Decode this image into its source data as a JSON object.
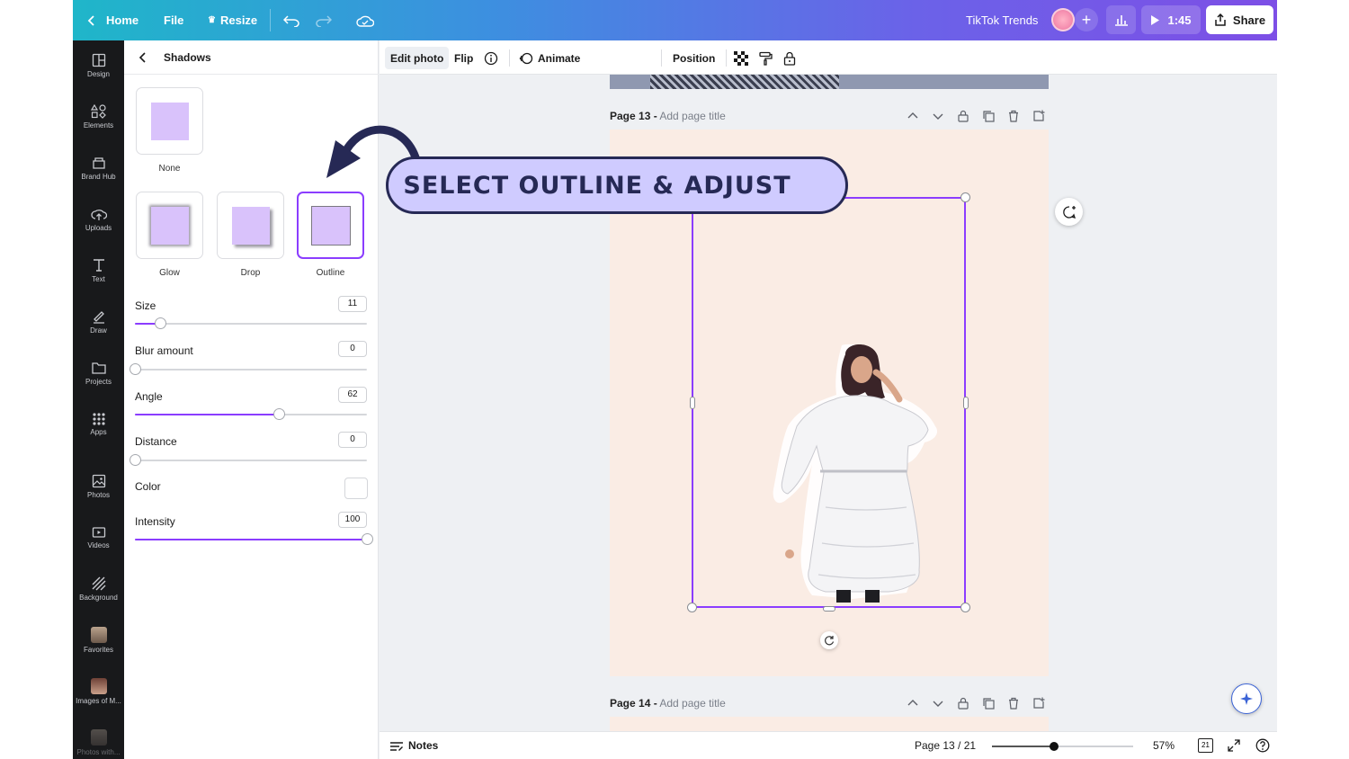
{
  "topbar": {
    "home_label": "Home",
    "file_label": "File",
    "resize_label": "Resize",
    "project_title": "TikTok Trends",
    "present_time": "1:45",
    "share_label": "Share"
  },
  "rail": {
    "items": [
      {
        "label": "Design",
        "icon": "design-icon"
      },
      {
        "label": "Elements",
        "icon": "elements-icon"
      },
      {
        "label": "Brand Hub",
        "icon": "brand-hub-icon"
      },
      {
        "label": "Uploads",
        "icon": "cloud-upload-icon"
      },
      {
        "label": "Text",
        "icon": "text-icon"
      },
      {
        "label": "Draw",
        "icon": "draw-icon"
      },
      {
        "label": "Projects",
        "icon": "folder-icon"
      },
      {
        "label": "Apps",
        "icon": "apps-grid-icon"
      },
      {
        "label": "Photos",
        "icon": "photo-icon"
      },
      {
        "label": "Videos",
        "icon": "video-icon"
      },
      {
        "label": "Background",
        "icon": "background-icon"
      },
      {
        "label": "Favorites",
        "icon": "favorites-thumb"
      },
      {
        "label": "Images of M...",
        "icon": "folder-thumb"
      },
      {
        "label": "Photos with...",
        "icon": "folder-thumb"
      }
    ]
  },
  "panel": {
    "title": "Shadows",
    "options": [
      {
        "label": "None",
        "selected": false
      },
      {
        "label": "Glow",
        "selected": false
      },
      {
        "label": "Drop",
        "selected": false
      },
      {
        "label": "Outline",
        "selected": true
      }
    ],
    "controls": {
      "size": {
        "label": "Size",
        "value": "11",
        "fraction": 0.11
      },
      "blur": {
        "label": "Blur amount",
        "value": "0",
        "fraction": 0
      },
      "angle": {
        "label": "Angle",
        "value": "62",
        "fraction": 0.62
      },
      "distance": {
        "label": "Distance",
        "value": "0",
        "fraction": 0
      },
      "color": {
        "label": "Color",
        "value": "#ffffff"
      },
      "intensity": {
        "label": "Intensity",
        "value": "100",
        "fraction": 1.0
      }
    }
  },
  "toolbar": {
    "edit_photo": "Edit photo",
    "flip": "Flip",
    "animate": "Animate",
    "position": "Position"
  },
  "pages": {
    "p13": {
      "number": "Page 13 -",
      "title_placeholder": "Add page title"
    },
    "p14": {
      "number": "Page 14 -",
      "title_placeholder": "Add page title"
    }
  },
  "callout": {
    "text": "SELECT OUTLINE & ADJUST"
  },
  "footer": {
    "notes": "Notes",
    "page_counter": "Page 13 / 21",
    "zoom": "57%",
    "zoom_fraction": 0.44,
    "grid_count": "21"
  },
  "colors": {
    "accent": "#8b3dff",
    "page_bg": "#faece4",
    "callout_bg": "#cfcbff",
    "callout_ink": "#262955"
  }
}
